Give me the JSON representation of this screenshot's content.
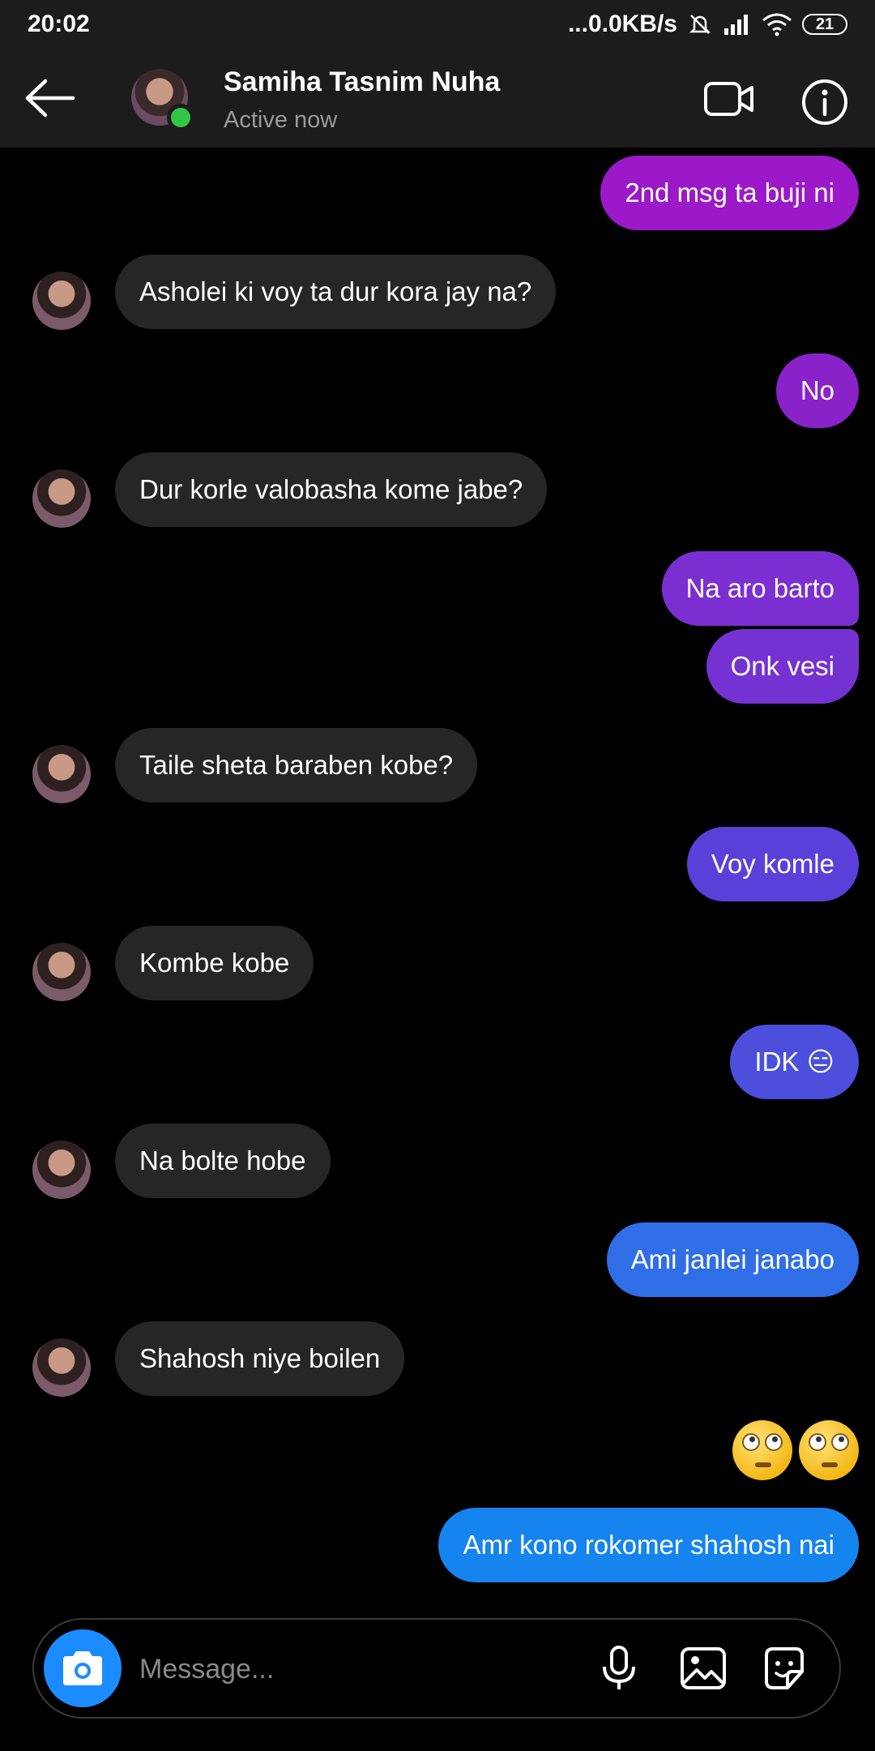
{
  "status": {
    "time": "20:02",
    "network": "...0.0KB/s",
    "battery": "21"
  },
  "header": {
    "name": "Samiha Tasnim Nuha",
    "status": "Active now"
  },
  "colors": {
    "header_bg": "#1c1c1c",
    "incoming_bubble": "#262626",
    "online": "#31c744",
    "camera_button": "#1a8cff"
  },
  "messages": [
    {
      "side": "out",
      "text": "2nd msg ta buji ni",
      "color": "#9b19c9"
    },
    {
      "side": "in",
      "text": "Asholei ki voy ta dur kora jay na?"
    },
    {
      "side": "out",
      "text": "No",
      "color": "#8a22c9"
    },
    {
      "side": "in",
      "text": "Dur korle valobasha kome jabe?"
    },
    {
      "side": "out",
      "text": "Na aro barto",
      "color": "#7b2fd0"
    },
    {
      "side": "out",
      "text": "Onk vesi",
      "color": "#7432d2"
    },
    {
      "side": "in",
      "text": "Taile sheta baraben kobe?"
    },
    {
      "side": "out",
      "text": "Voy komle",
      "color": "#5a40d8"
    },
    {
      "side": "in",
      "text": "Kombe kobe"
    },
    {
      "side": "out",
      "text": "IDK 😑",
      "color": "#4b4fdc"
    },
    {
      "side": "in",
      "text": "Na bolte hobe"
    },
    {
      "side": "out",
      "text": "Ami janlei janabo",
      "color": "#2f6ee6"
    },
    {
      "side": "in",
      "text": "Shahosh niye boilen"
    },
    {
      "side": "out",
      "text": "Amr kono rokomer shahosh nai",
      "color": "#1684ee"
    }
  ],
  "reaction_emojis": [
    "face-with-rolling-eyes",
    "face-with-rolling-eyes"
  ],
  "composer": {
    "placeholder": "Message..."
  }
}
